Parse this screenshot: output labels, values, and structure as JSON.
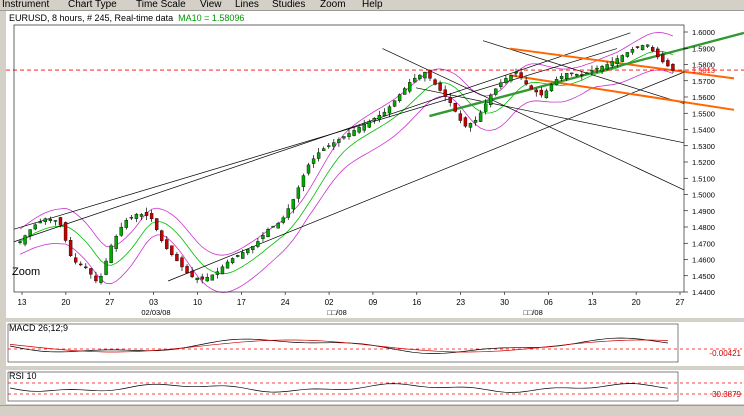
{
  "menu": [
    "Instrument",
    "Chart Type",
    "Time Scale",
    "View",
    "Lines",
    "Studies",
    "Zoom",
    "Help"
  ],
  "info": {
    "symbol": "EURUSD",
    "interval": ", 8 hours, # 245, Real-time data",
    "ma_label": "MA10 = 1.58096"
  },
  "zoom_label": "Zoom",
  "price_axis": [
    "1.6000",
    "1.5900",
    "1.5800",
    "1.5700",
    "1.5600",
    "1.5500",
    "1.5400",
    "1.5300",
    "1.5200",
    "1.5100",
    "1.5000",
    "1.4900",
    "1.4800",
    "1.4700",
    "1.4600",
    "1.4500",
    "1.4400"
  ],
  "current_price": "1.5813",
  "date_axis": [
    "13",
    "20",
    "27",
    "03",
    "10",
    "17",
    "24",
    "02",
    "09",
    "16",
    "23",
    "30",
    "06",
    "13",
    "20",
    "27"
  ],
  "month_labels": [
    "02/03/08",
    "□□/08",
    "□□/08"
  ],
  "macd": {
    "title": "MACD 26;12;9",
    "level": "-0.00421"
  },
  "rsi": {
    "title": "RSI 10",
    "level": "30.3879"
  },
  "colors": {
    "background": "#ffffff",
    "candle_up": "#00aa00",
    "candle_down": "#cc0000",
    "bollinger": "#cc33cc",
    "moving_average": "#00bb00",
    "trendline": "#000000",
    "orange_channel": "#ff6600",
    "green_trendline": "#339933",
    "reference": "#ff0000",
    "ma_label": "#009900"
  },
  "chart_data": {
    "type": "candlestick",
    "instrument": "EURUSD",
    "ylim": [
      1.44,
      1.61
    ],
    "x_ticks": [
      "13",
      "20",
      "27",
      "03",
      "10",
      "17",
      "24",
      "02",
      "09",
      "16",
      "23",
      "30",
      "06",
      "13",
      "20",
      "27"
    ],
    "close_series": [
      1.472,
      1.482,
      1.487,
      1.485,
      1.46,
      1.456,
      1.445,
      1.47,
      1.485,
      1.49,
      1.488,
      1.47,
      1.46,
      1.45,
      1.448,
      1.452,
      1.46,
      1.465,
      1.47,
      1.48,
      1.485,
      1.5,
      1.52,
      1.53,
      1.535,
      1.54,
      1.545,
      1.55,
      1.555,
      1.565,
      1.575,
      1.58,
      1.57,
      1.56,
      1.545,
      1.55,
      1.565,
      1.575,
      1.58,
      1.57,
      1.565,
      1.575,
      1.58,
      1.578,
      1.582,
      1.585,
      1.59,
      1.595,
      1.598,
      1.588,
      1.5813
    ],
    "reference_price": 1.5813
  }
}
